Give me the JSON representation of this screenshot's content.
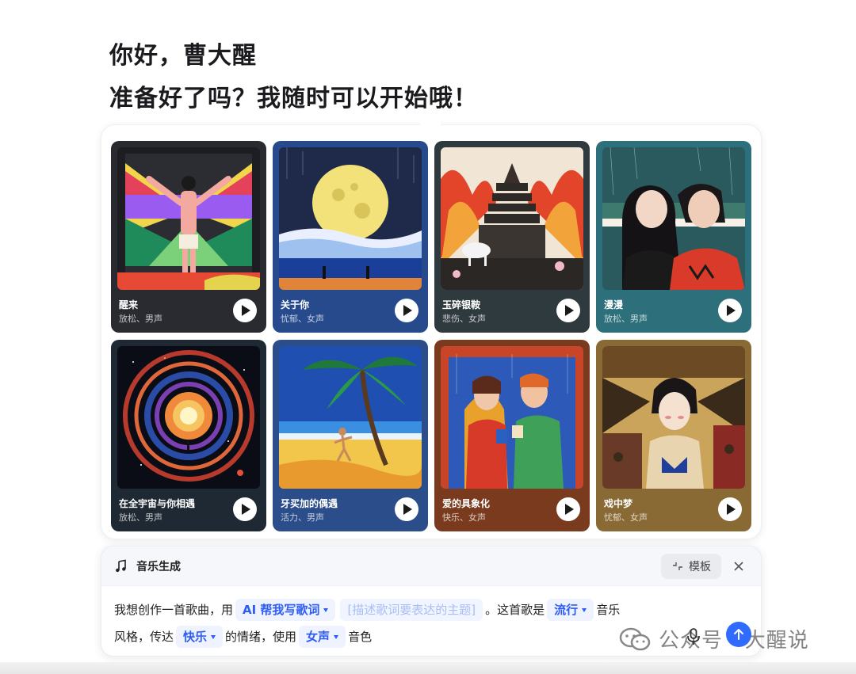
{
  "greeting": {
    "line1": "你好，曹大醒",
    "line2": "准备好了吗？我随时可以开始哦！"
  },
  "cards": [
    {
      "title": "醒来",
      "tags": "放松、男声",
      "bg": "#2a2b31"
    },
    {
      "title": "关于你",
      "tags": "忧郁、女声",
      "bg": "#264a8c"
    },
    {
      "title": "玉碎银鞍",
      "tags": "悲伤、女声",
      "bg": "#2f3a3f"
    },
    {
      "title": "漫漫",
      "tags": "放松、男声",
      "bg": "#2e6f7c"
    },
    {
      "title": "在全宇宙与你相遇",
      "tags": "放松、男声",
      "bg": "#1f2933"
    },
    {
      "title": "牙买加的偶遇",
      "tags": "活力、男声",
      "bg": "#2b4d8a"
    },
    {
      "title": "爱的具象化",
      "tags": "快乐、女声",
      "bg": "#7a3a1e"
    },
    {
      "title": "戏中梦",
      "tags": "忧郁、女声",
      "bg": "#8a6a34"
    }
  ],
  "composer": {
    "title": "音乐生成",
    "template_label": "模板",
    "text1": "我想创作一首歌曲，用",
    "chip_ai": "AI 帮我写歌词",
    "placeholder": "[描述歌词要表达的主题]",
    "text2": "。这首歌是",
    "chip_genre": "流行",
    "text3": "音乐",
    "text4": "风格，传达",
    "chip_mood": "快乐",
    "text5": "的情绪，使用",
    "chip_voice": "女声",
    "text6": "音色"
  },
  "watermark": {
    "text": "公众号 · 大醒说"
  },
  "colors": {
    "accent": "#2f6bff",
    "chip_bg": "#eef3ff"
  },
  "icons": [
    "music-note-icon",
    "collapse-icon",
    "close-icon",
    "mic-icon",
    "send-arrow-icon",
    "wechat-logo-icon"
  ]
}
